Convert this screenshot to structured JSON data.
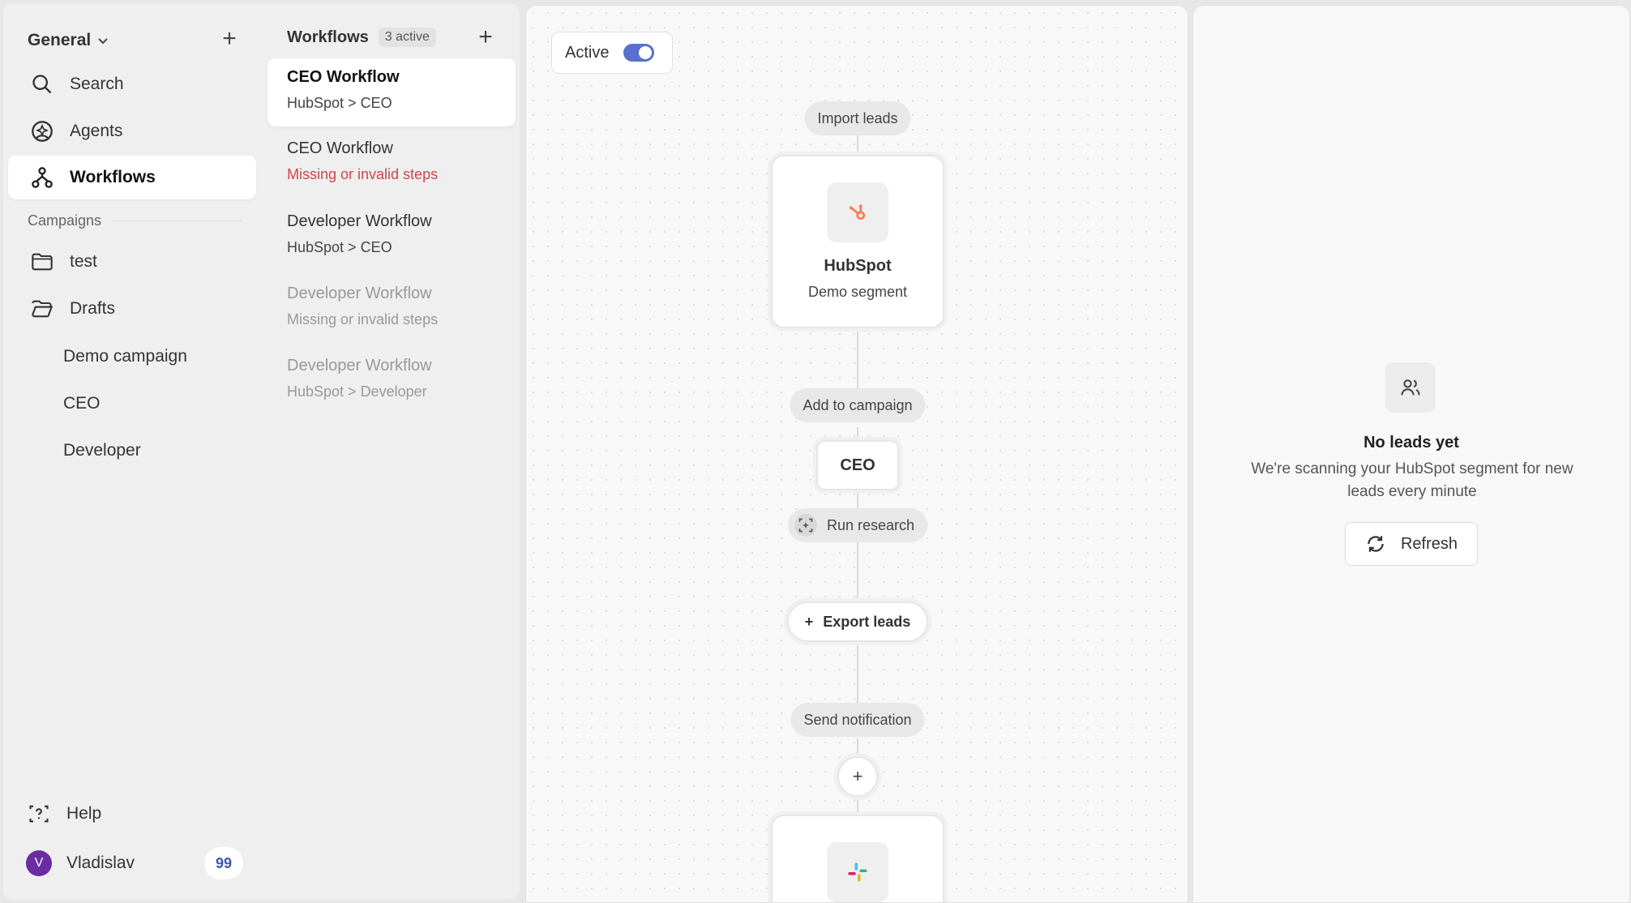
{
  "sidebar": {
    "workspace": "General",
    "nav": [
      {
        "label": "Search",
        "icon": "search-icon"
      },
      {
        "label": "Agents",
        "icon": "agent-icon"
      },
      {
        "label": "Workflows",
        "icon": "workflow-icon"
      }
    ],
    "campaigns_label": "Campaigns",
    "folders": [
      {
        "label": "test",
        "icon": "folder-icon"
      },
      {
        "label": "Drafts",
        "icon": "folder-open-icon"
      }
    ],
    "draft_items": [
      "Demo campaign",
      "CEO",
      "Developer"
    ],
    "help_label": "Help",
    "user": {
      "initial": "V",
      "name": "Vladislav",
      "count": "99"
    }
  },
  "workflows": {
    "title": "Workflows",
    "badge": "3 active",
    "items": [
      {
        "name": "CEO Workflow",
        "sub": "HubSpot > CEO"
      },
      {
        "name": "CEO Workflow",
        "sub": "Missing or invalid steps"
      },
      {
        "name": "Developer Workflow",
        "sub": "HubSpot > CEO"
      },
      {
        "name": "Developer Workflow",
        "sub": "Missing or invalid steps"
      },
      {
        "name": "Developer Workflow",
        "sub": "HubSpot > Developer"
      }
    ]
  },
  "canvas": {
    "active_label": "Active",
    "import_leads": "Import leads",
    "source_card": {
      "title": "HubSpot",
      "subtitle": "Demo segment"
    },
    "add_to_campaign": "Add to campaign",
    "campaign_name": "CEO",
    "run_research": "Run research",
    "export_leads": "Export leads",
    "send_notification": "Send notification",
    "add_step": "+"
  },
  "panel": {
    "title": "No leads yet",
    "desc": "We're scanning your HubSpot segment for new leads every minute",
    "refresh": "Refresh"
  },
  "colors": {
    "accent": "#5a6fd0",
    "error": "#d0454c",
    "hubspot": "#ff7a59",
    "avatar": "#6b2ba3"
  }
}
